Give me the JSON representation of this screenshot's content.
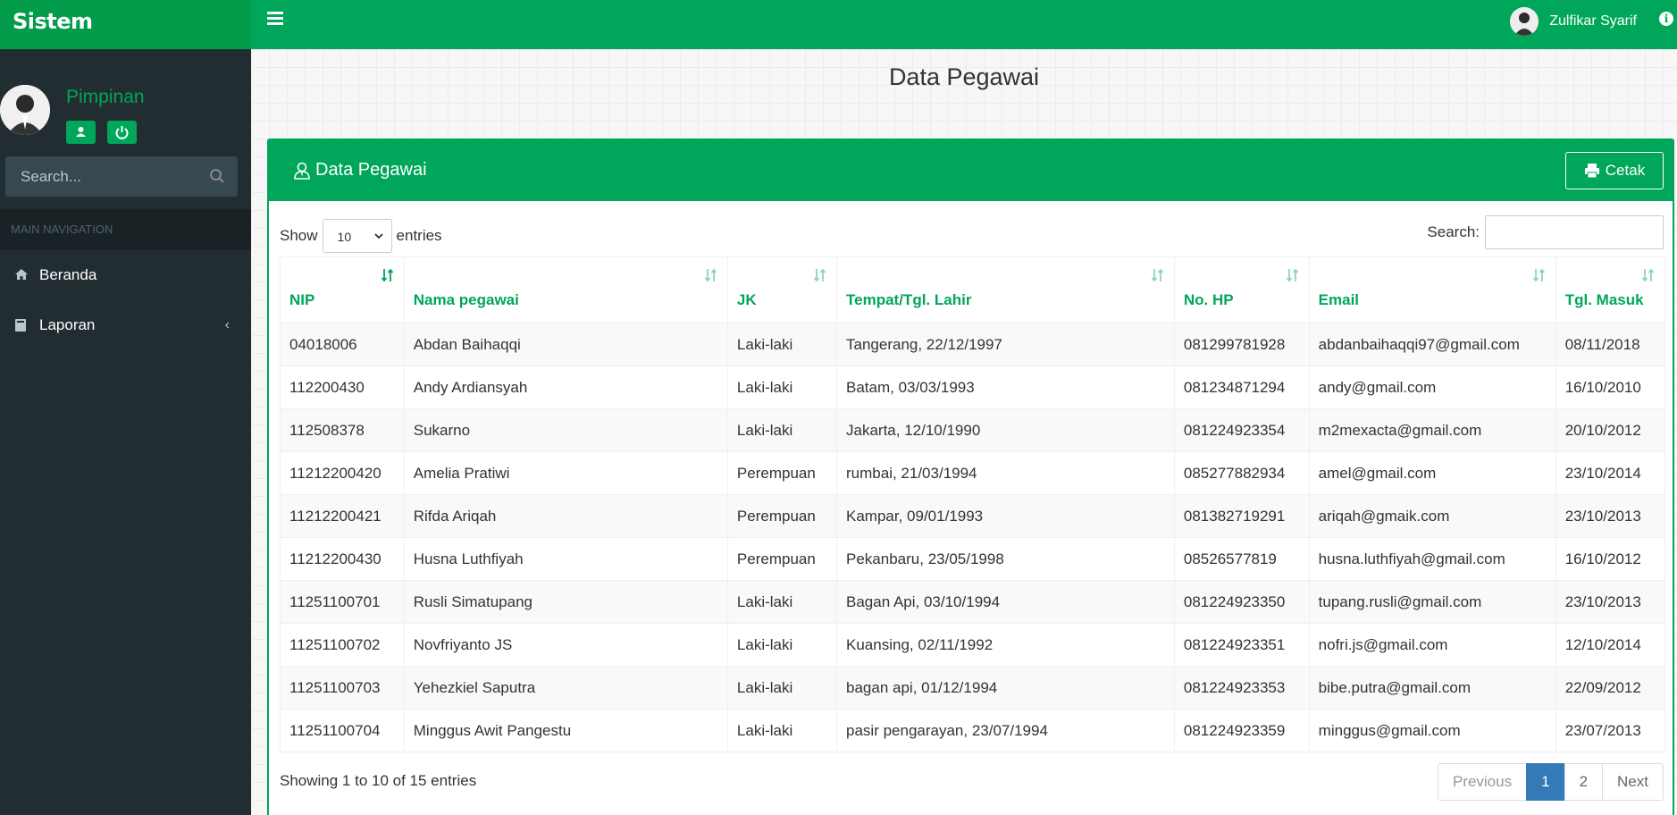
{
  "app": {
    "title": "Sistem Kepegawaian"
  },
  "topbar": {
    "user_name": "Zulfikar Syarif"
  },
  "sidebar": {
    "role": "Pimpinan",
    "search_placeholder": "Search...",
    "nav_header": "MAIN NAVIGATION",
    "items": [
      {
        "label": "Beranda",
        "icon": "home-icon"
      },
      {
        "label": "Laporan",
        "icon": "book-icon"
      }
    ]
  },
  "page": {
    "title": "Data Pegawai"
  },
  "box": {
    "title": "Data Pegawai",
    "print_label": "Cetak"
  },
  "table_controls": {
    "show_label": "Show",
    "entries_label": "entries",
    "length_value": "10",
    "search_label": "Search:",
    "search_value": ""
  },
  "table": {
    "columns": [
      "NIP",
      "Nama pegawai",
      "JK",
      "Tempat/Tgl. Lahir",
      "No. HP",
      "Email",
      "Tgl. Masuk"
    ],
    "rows": [
      [
        "04018006",
        "Abdan Baihaqqi",
        "Laki-laki",
        "Tangerang, 22/12/1997",
        "081299781928",
        "abdanbaihaqqi97@gmail.com",
        "08/11/2018"
      ],
      [
        "112200430",
        "Andy Ardiansyah",
        "Laki-laki",
        "Batam, 03/03/1993",
        "081234871294",
        "andy@gmail.com",
        "16/10/2010"
      ],
      [
        "112508378",
        "Sukarno",
        "Laki-laki",
        "Jakarta, 12/10/1990",
        "081224923354",
        "m2mexacta@gmail.com",
        "20/10/2012"
      ],
      [
        "11212200420",
        "Amelia Pratiwi",
        "Perempuan",
        "rumbai, 21/03/1994",
        "085277882934",
        "amel@gmail.com",
        "23/10/2014"
      ],
      [
        "11212200421",
        "Rifda Ariqah",
        "Perempuan",
        "Kampar, 09/01/1993",
        "081382719291",
        "ariqah@gmaik.com",
        "23/10/2013"
      ],
      [
        "11212200430",
        "Husna Luthfiyah",
        "Perempuan",
        "Pekanbaru, 23/05/1998",
        "08526577819",
        "husna.luthfiyah@gmail.com",
        "16/10/2012"
      ],
      [
        "11251100701",
        "Rusli Simatupang",
        "Laki-laki",
        "Bagan Api, 03/10/1994",
        "081224923350",
        "tupang.rusli@gmail.com",
        "23/10/2013"
      ],
      [
        "11251100702",
        "Novfriyanto JS",
        "Laki-laki",
        "Kuansing, 02/11/1992",
        "081224923351",
        "nofri.js@gmail.com",
        "12/10/2014"
      ],
      [
        "11251100703",
        "Yehezkiel Saputra",
        "Laki-laki",
        "bagan api, 01/12/1994",
        "081224923353",
        "bibe.putra@gmail.com",
        "22/09/2012"
      ],
      [
        "11251100704",
        "Minggus Awit Pangestu",
        "Laki-laki",
        "pasir pengarayan, 23/07/1994",
        "081224923359",
        "minggus@gmail.com",
        "23/07/2013"
      ]
    ]
  },
  "footer": {
    "info": "Showing 1 to 10 of 15 entries",
    "pagination": {
      "previous": "Previous",
      "pages": [
        "1",
        "2"
      ],
      "active": "1",
      "next": "Next"
    }
  },
  "colors": {
    "brand": "#00a65a",
    "brand_dark": "#029c4a",
    "sidebar": "#222d32",
    "active_page": "#337ab7"
  }
}
